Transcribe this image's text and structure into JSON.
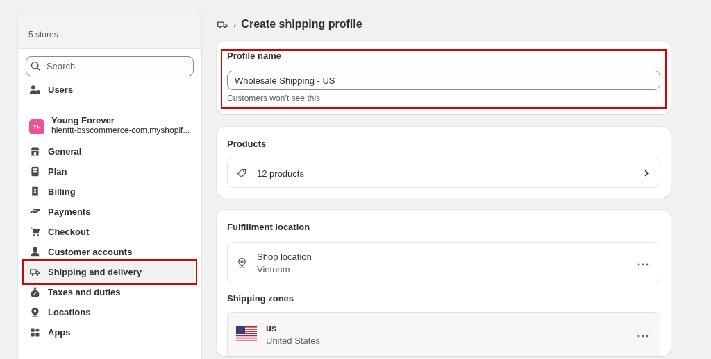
{
  "sidebar": {
    "store_count": "5 stores",
    "search": {
      "placeholder": "Search"
    },
    "users_item": {
      "label": "Users"
    },
    "store": {
      "initials": "YF",
      "name": "Young Forever",
      "domain": "hienttt-bsscommerce-com.myshopif..."
    },
    "items": [
      {
        "label": "General",
        "selected": false,
        "highlighted": false
      },
      {
        "label": "Plan",
        "selected": false,
        "highlighted": false
      },
      {
        "label": "Billing",
        "selected": false,
        "highlighted": false
      },
      {
        "label": "Payments",
        "selected": false,
        "highlighted": false
      },
      {
        "label": "Checkout",
        "selected": false,
        "highlighted": false
      },
      {
        "label": "Customer accounts",
        "selected": false,
        "highlighted": false
      },
      {
        "label": "Shipping and delivery",
        "selected": true,
        "highlighted": true
      },
      {
        "label": "Taxes and duties",
        "selected": false,
        "highlighted": false
      },
      {
        "label": "Locations",
        "selected": false,
        "highlighted": false
      },
      {
        "label": "Apps",
        "selected": false,
        "highlighted": false
      }
    ]
  },
  "header": {
    "separator": "›",
    "title": "Create shipping profile"
  },
  "profile_name": {
    "label": "Profile name",
    "value": "Wholesale Shipping - US",
    "help": "Customers won’t see this",
    "highlighted": true
  },
  "products": {
    "title": "Products",
    "count": "12 products"
  },
  "fulfillment": {
    "title": "Fulfillment location",
    "location_name": "Shop location",
    "location_country": "Vietnam"
  },
  "shipping_zones": {
    "title": "Shipping zones",
    "zones": [
      {
        "name": "us",
        "country": "United States"
      }
    ]
  }
}
